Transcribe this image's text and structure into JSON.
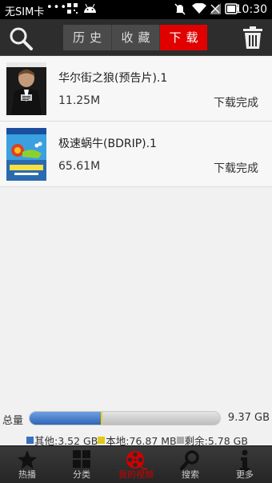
{
  "status_bar": {
    "carrier": "无SIM卡",
    "dots": "•••",
    "time": "10:30",
    "icons": [
      "qr-icon",
      "android-icon",
      "mute-icon",
      "wifi-icon",
      "battery-icon"
    ]
  },
  "toolbar": {
    "tabs": [
      {
        "label": "历史",
        "active": false
      },
      {
        "label": "收藏",
        "active": false
      },
      {
        "label": "下载",
        "active": true
      }
    ],
    "accent_color": "#e00000"
  },
  "downloads": [
    {
      "title": "华尔街之狼(预告片).1",
      "size": "11.25M",
      "status": "下载完成",
      "thumbnail": "wolf-of-wall-street-poster"
    },
    {
      "title": "极速蜗牛(BDRIP).1",
      "size": "65.61M",
      "status": "下载完成",
      "thumbnail": "turbo-poster"
    }
  ],
  "storage": {
    "label": "总量",
    "total": "9.37 GB",
    "other_fraction": 0.376,
    "local_fraction": 0.008,
    "legend": [
      {
        "text": "其他:3.52 GB",
        "color": "#3a6fc0"
      },
      {
        "text": "本地:76.87 MB",
        "color": "#e0c818"
      },
      {
        "text": "剩余:5.78 GB",
        "color": "#aaaaaa"
      }
    ]
  },
  "bottom_nav": [
    {
      "label": "热播",
      "icon": "star-icon",
      "active": false
    },
    {
      "label": "分类",
      "icon": "grid-icon",
      "active": false
    },
    {
      "label": "我的视频",
      "icon": "film-reel-icon",
      "active": true
    },
    {
      "label": "搜索",
      "icon": "search-icon",
      "active": false
    },
    {
      "label": "更多",
      "icon": "info-icon",
      "active": false
    }
  ]
}
